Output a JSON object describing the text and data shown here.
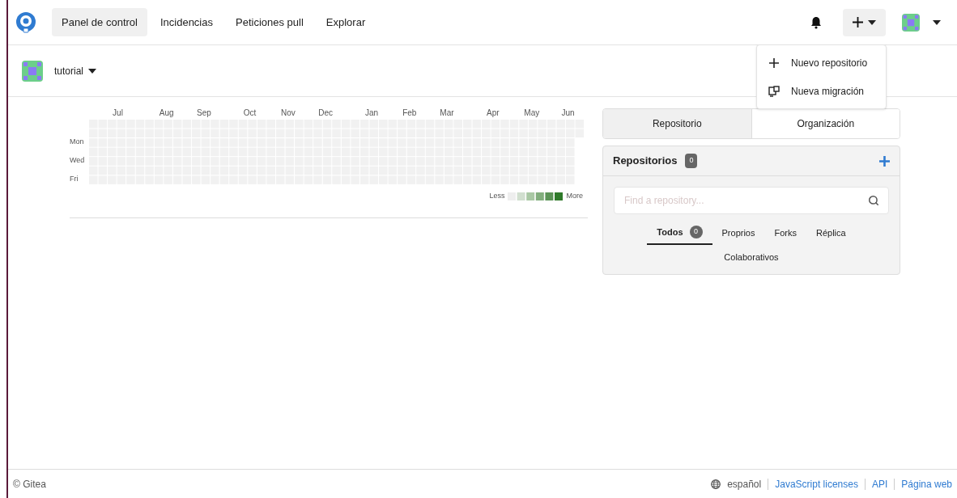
{
  "navbar": {
    "items": [
      {
        "label": "Panel de control",
        "selected": true
      },
      {
        "label": "Incidencias",
        "selected": false
      },
      {
        "label": "Peticiones pull",
        "selected": false
      },
      {
        "label": "Explorar",
        "selected": false
      }
    ]
  },
  "create_menu": {
    "expanded": true,
    "items": [
      {
        "kind": "new",
        "label": "Nuevo repositorio"
      },
      {
        "kind": "migrate",
        "label": "Nueva migración"
      }
    ]
  },
  "context": {
    "user": "tutorial"
  },
  "heatmap": {
    "months": [
      "Jul",
      "Aug",
      "Sep",
      "Oct",
      "Nov",
      "Dec",
      "Jan",
      "Feb",
      "Mar",
      "Apr",
      "May",
      "Jun"
    ],
    "days": [
      "Mon",
      "Wed",
      "Fri"
    ],
    "legend_less": "Less",
    "legend_more": "More"
  },
  "switch_tabs": [
    {
      "label": "Repositorio",
      "selected": true
    },
    {
      "label": "Organización",
      "selected": false
    }
  ],
  "repos": {
    "title": "Repositorios",
    "count": "0",
    "search_placeholder": "Find a repository...",
    "filters": [
      {
        "label": "Todos",
        "count": "0",
        "selected": true
      },
      {
        "label": "Proprios",
        "selected": false
      },
      {
        "label": "Forks",
        "selected": false
      },
      {
        "label": "Réplica",
        "selected": false
      },
      {
        "label": "Colaborativos",
        "selected": false
      }
    ]
  },
  "footer": {
    "copyright": "© Gitea",
    "language": "español",
    "links": [
      "JavaScript licenses",
      "API",
      "Página web"
    ]
  }
}
